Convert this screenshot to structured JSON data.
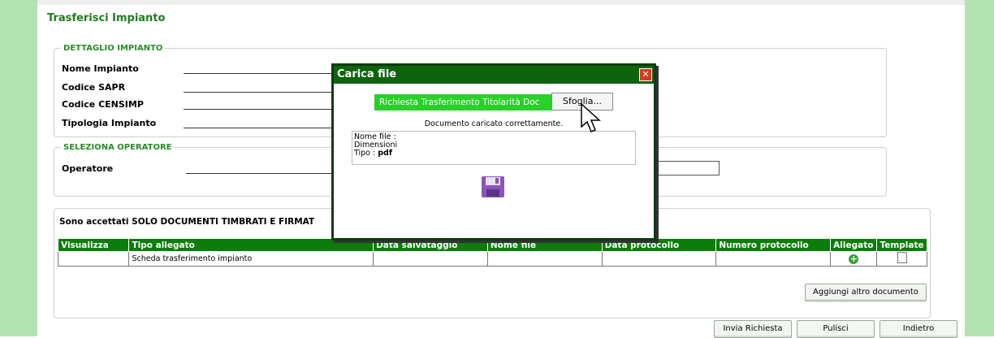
{
  "page_title": "Trasferisci Impianto",
  "dettaglio": {
    "legend": "DETTAGLIO IMPIANTO",
    "fields": [
      {
        "label": "Nome Impianto"
      },
      {
        "label": "Codice SAPR"
      },
      {
        "label": "Codice CENSIMP"
      },
      {
        "label": "Tipologia Impianto"
      }
    ]
  },
  "operatore": {
    "legend": "SELEZIONA OPERATORE",
    "label": "Operatore"
  },
  "allegati": {
    "notice": "Sono accettati SOLO DOCUMENTI TIMBRATI E FIRMAT",
    "headers": [
      "Visualizza",
      "Tipo allegato",
      "Data salvataggio",
      "Nome file",
      "Data protocollo",
      "Numero protocollo",
      "Allegato",
      "Template"
    ],
    "rows": [
      {
        "visualizza": "",
        "tipo": "Scheda trasferimento impianto",
        "data_salvataggio": "",
        "nome_file": "",
        "data_protocollo": "",
        "numero_protocollo": ""
      }
    ],
    "add_button": "Aggiungi altro documento"
  },
  "actions": {
    "invia": "Invia Richiesta",
    "pulisci": "Pulisci",
    "indietro": "Indietro"
  },
  "modal": {
    "title": "Carica file",
    "close": "✕",
    "file_label": "Richiesta Trasferimento Titolarità Doc",
    "browse": "Sfoglia...",
    "uploaded_msg": "Documento caricato correttamente.",
    "info": {
      "nome_label": "Nome file :",
      "dim_label": "Dimensioni",
      "tipo_label": "Tipo :",
      "tipo_value": "pdf"
    }
  },
  "colors": {
    "accent_green": "#0a7d0a",
    "side_green": "#b3e2b3",
    "file_label_green": "#27d127"
  }
}
